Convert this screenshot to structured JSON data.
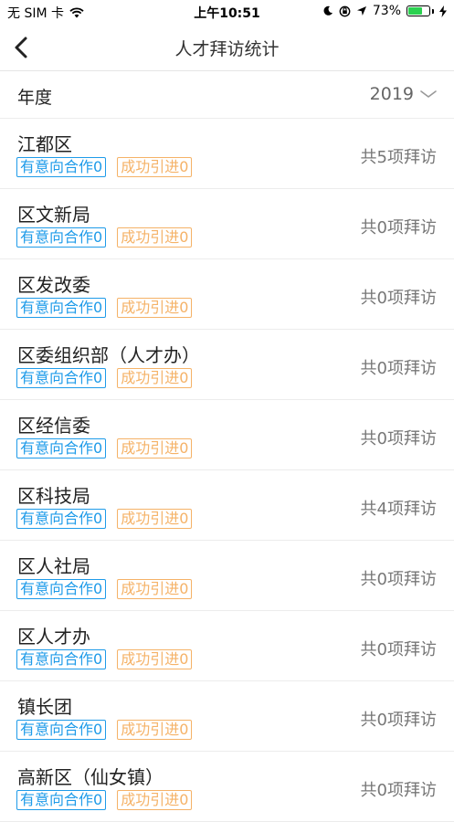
{
  "status_bar": {
    "carrier": "无 SIM 卡",
    "time": "上午10:51",
    "battery": "73%",
    "battery_level": 0.73
  },
  "nav": {
    "title": "人才拜访统计"
  },
  "filter": {
    "label": "年度",
    "year": "2019"
  },
  "rows": [
    {
      "name": "江都区",
      "tag_intent": "有意向合作0",
      "tag_success": "成功引进0",
      "count": "共5项拜访"
    },
    {
      "name": "区文新局",
      "tag_intent": "有意向合作0",
      "tag_success": "成功引进0",
      "count": "共0项拜访"
    },
    {
      "name": "区发改委",
      "tag_intent": "有意向合作0",
      "tag_success": "成功引进0",
      "count": "共0项拜访"
    },
    {
      "name": "区委组织部（人才办）",
      "tag_intent": "有意向合作0",
      "tag_success": "成功引进0",
      "count": "共0项拜访"
    },
    {
      "name": "区经信委",
      "tag_intent": "有意向合作0",
      "tag_success": "成功引进0",
      "count": "共0项拜访"
    },
    {
      "name": "区科技局",
      "tag_intent": "有意向合作0",
      "tag_success": "成功引进0",
      "count": "共4项拜访"
    },
    {
      "name": "区人社局",
      "tag_intent": "有意向合作0",
      "tag_success": "成功引进0",
      "count": "共0项拜访"
    },
    {
      "name": "区人才办",
      "tag_intent": "有意向合作0",
      "tag_success": "成功引进0",
      "count": "共0项拜访"
    },
    {
      "name": "镇长团",
      "tag_intent": "有意向合作0",
      "tag_success": "成功引进0",
      "count": "共0项拜访"
    },
    {
      "name": "高新区（仙女镇）",
      "tag_intent": "有意向合作0",
      "tag_success": "成功引进0",
      "count": "共0项拜访"
    }
  ],
  "colors": {
    "tag_blue": "#1e9be9",
    "tag_orange": "#f5b267",
    "battery_green": "#2bd150"
  }
}
